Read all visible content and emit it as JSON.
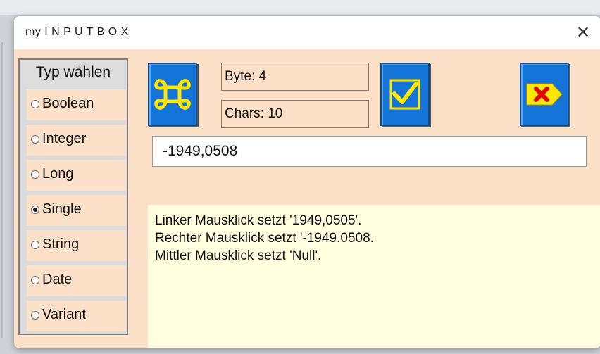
{
  "window": {
    "title": "my I N P U T B O X",
    "close_glyph": "✕"
  },
  "type_group": {
    "title": "Typ wählen",
    "options": [
      {
        "label": "Boolean",
        "selected": false
      },
      {
        "label": "Integer",
        "selected": false
      },
      {
        "label": "Long",
        "selected": false
      },
      {
        "label": "Single",
        "selected": true
      },
      {
        "label": "String",
        "selected": false
      },
      {
        "label": "Date",
        "selected": false
      },
      {
        "label": "Variant",
        "selected": false
      }
    ]
  },
  "info": {
    "bytes": "Byte: 4",
    "chars": "Chars: 10"
  },
  "buttons": {
    "command": {
      "icon": "command-key-icon"
    },
    "ok": {
      "icon": "checkmark-icon"
    },
    "cancel": {
      "icon": "cancel-x-icon"
    }
  },
  "input": {
    "value": "-1949,0508"
  },
  "message": {
    "lines": [
      "Linker Mausklick setzt '1949,0505'.",
      "Rechter Mausklick setzt '-1949.0508.",
      "Mittler Mausklick setzt 'Null'."
    ]
  },
  "colors": {
    "dialog_bg": "#fde0c8",
    "button_blue": "#1473d6",
    "icon_yellow": "#ffe600",
    "cancel_red": "#e00000",
    "message_bg": "#ffffdf"
  }
}
